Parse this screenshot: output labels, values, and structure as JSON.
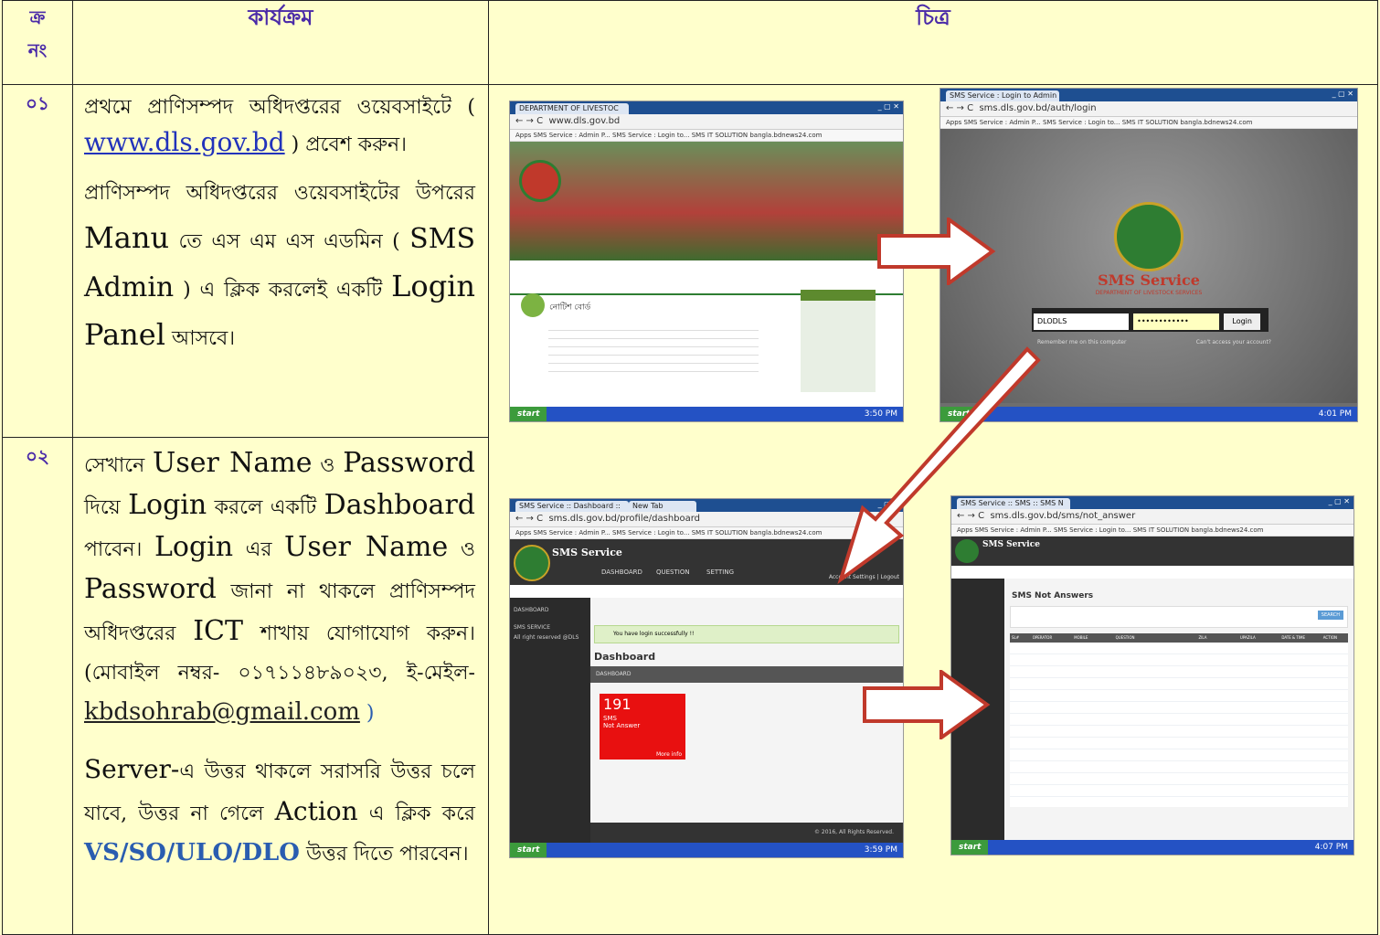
{
  "header": {
    "num_line1": "ক্র",
    "num_line2": "নং",
    "task": "কার্যক্রম",
    "picture": "চিত্র"
  },
  "rows": [
    {
      "num": "০১",
      "p1_a": "প্রথমে প্রাণিসম্পদ অধিদপ্তরের ওয়েবসাইটে (",
      "p1_link": "www.dls.gov.bd",
      "p1_b": ") প্রবেশ করুন।",
      "p2_a": "প্রাণিসম্পদ অধিদপ্তরের ওয়েবসাইটের উপরের",
      "p2_b": "Manu",
      "p2_c": "তে এস এম এস এডমিন (",
      "p2_d": "SMS Admin",
      "p2_e": ") এ ক্লিক করলেই একটি",
      "p2_f": "Login Panel",
      "p2_g": "আসবে।"
    },
    {
      "num": "০২",
      "p1_a": "সেখানে",
      "p1_b": "User Name",
      "p1_c": "ও",
      "p1_d": "Password",
      "p1_e": "দিয়ে",
      "p1_f": "Login",
      "p1_g": "করলে একটি",
      "p1_h": "Dashboard",
      "p1_i": "পাবেন।",
      "p1_j": "Login",
      "p1_k": "এর",
      "p1_l": "User Name",
      "p1_m": "ও",
      "p1_n": "Password",
      "p1_o": "জানা না থাকলে প্রাণিসম্পদ অধিদপ্তরের",
      "p1_p": "ICT",
      "p1_q": "শাখায় যোগাযোগ করুন। (মোবাইল নম্বর- ০১৭১১৪৮৯০২৩, ই-মেইল-",
      "p1_mail": "kbdsohrab@gmail.com",
      "p1_close": ")",
      "p2_a": "Server-",
      "p2_b": "এ উত্তর থাকলে সরাসরি উত্তর চলে যাবে, উত্তর না গেলে",
      "p2_c": "Action",
      "p2_d": "এ ক্লিক করে",
      "p2_e": "VS/SO/ULO/DLO",
      "p2_f": "উত্তর দিতে পারবেন।"
    }
  ],
  "shots": {
    "s1": {
      "tab": "DEPARTMENT OF LIVESTOC",
      "url": "www.dls.gov.bd",
      "bookmarks": "Apps  SMS Service : Admin P...  SMS Service : Login to...  SMS IT SOLUTION  bangla.bdnews24.com",
      "notice": "নোটিশ বোর্ড",
      "time": "3:50 PM"
    },
    "s2": {
      "tab": "SMS Service : Login to Admin",
      "url": "sms.dls.gov.bd/auth/login",
      "title": "SMS Service",
      "subtitle": "DEPARTMENT OF LIVESTOCK SERVICES",
      "user": "DLODLS",
      "pass": "••••••••••••",
      "login": "Login",
      "remember": "Remember me on this computer",
      "forgot": "Can't access your account?",
      "time": "4:01 PM"
    },
    "s3": {
      "tab": "SMS Service :: Dashboard ::",
      "tab2": "New Tab",
      "url": "sms.dls.gov.bd/profile/dashboard",
      "brand": "SMS Service",
      "nav1": "DASHBOARD",
      "nav2": "QUESTION",
      "nav3": "SETTING",
      "side1": "DASHBOARD",
      "side2": "SMS SERVICE",
      "side3": "All right reserved @DLS",
      "success": "You have login successfully !!",
      "heading": "Dashboard",
      "bar": "DASHBOARD",
      "count": "191",
      "count_l1": "SMS",
      "count_l2": "Not Answer",
      "more": "More info",
      "account": "Account Settings | Logout",
      "footer": "© 2016, All Rights Reserved.",
      "time": "3:59 PM"
    },
    "s4": {
      "tab": "SMS Service :: SMS :: SMS N",
      "url": "sms.dls.gov.bd/sms/not_answer",
      "brand": "SMS Service",
      "title": "SMS Not Answers",
      "search": "SEARCH",
      "cols": [
        "SL#",
        "OPERATOR",
        "MOBILE",
        "QUESTION",
        "ZILA",
        "UPAZILA",
        "DATE & TIME",
        "ACTION"
      ],
      "time": "4:07 PM"
    }
  },
  "colors": {
    "accent": "#4a2aa8",
    "background": "#ffffcc",
    "arrow": "#c0392b"
  }
}
